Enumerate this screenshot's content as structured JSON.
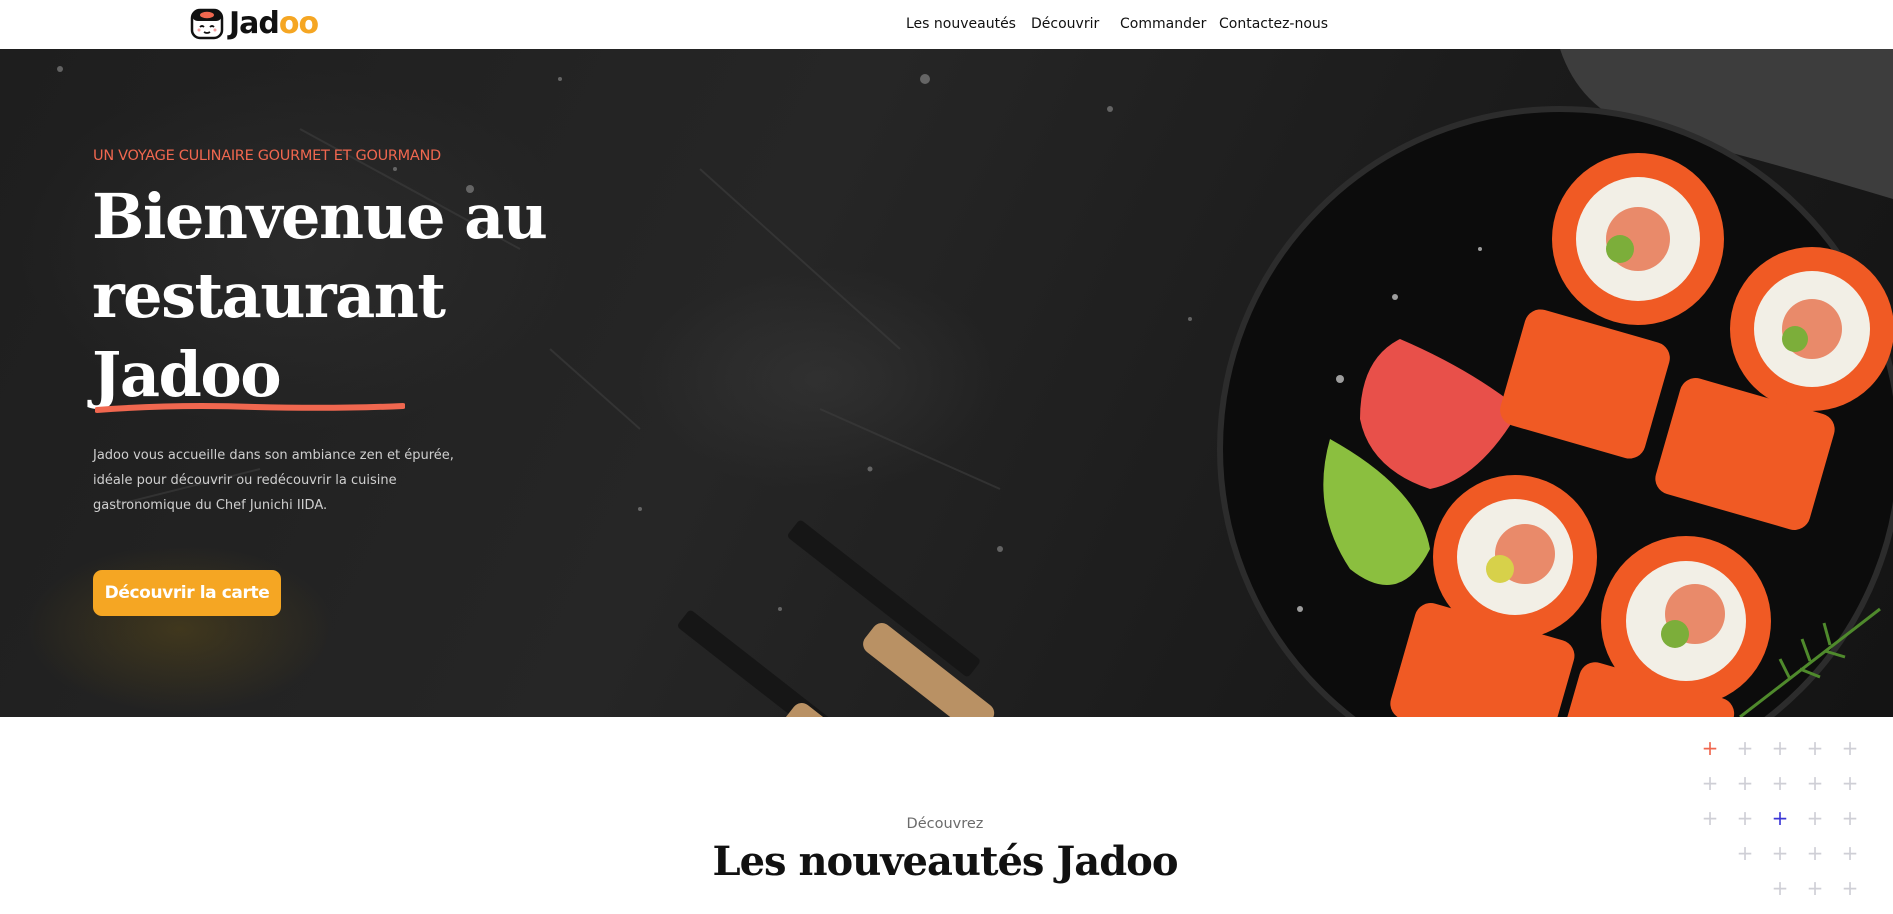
{
  "header": {
    "logo_text_main": "Jad",
    "logo_text_accent": "oo",
    "nav": [
      {
        "label": "Les nouveautés"
      },
      {
        "label": "Découvrir"
      },
      {
        "label": "Commander"
      },
      {
        "label": "Contactez-nous"
      }
    ]
  },
  "hero": {
    "tagline": "UN VOYAGE CULINAIRE GOURMET ET GOURMAND",
    "title_lines": [
      "Bienvenue au",
      "restaurant",
      "Jadoo"
    ],
    "description": "Jadoo vous accueille dans son ambiance zen et épurée, idéale pour découvrir ou redécouvrir la cuisine gastronomique du Chef Junichi IIDA.",
    "cta_label": "Découvrir la carte"
  },
  "section": {
    "subtitle": "Découvrez",
    "title": "Les nouveautés Jadoo"
  },
  "colors": {
    "accent": "#f5a623",
    "tagline": "#f0674f",
    "plus_grey": "#cfcfd6",
    "plus_orange": "#f0674f",
    "plus_blue": "#3b36d6"
  },
  "icons": {
    "logo": "sushi-face-icon",
    "decor": "plus-icon"
  }
}
